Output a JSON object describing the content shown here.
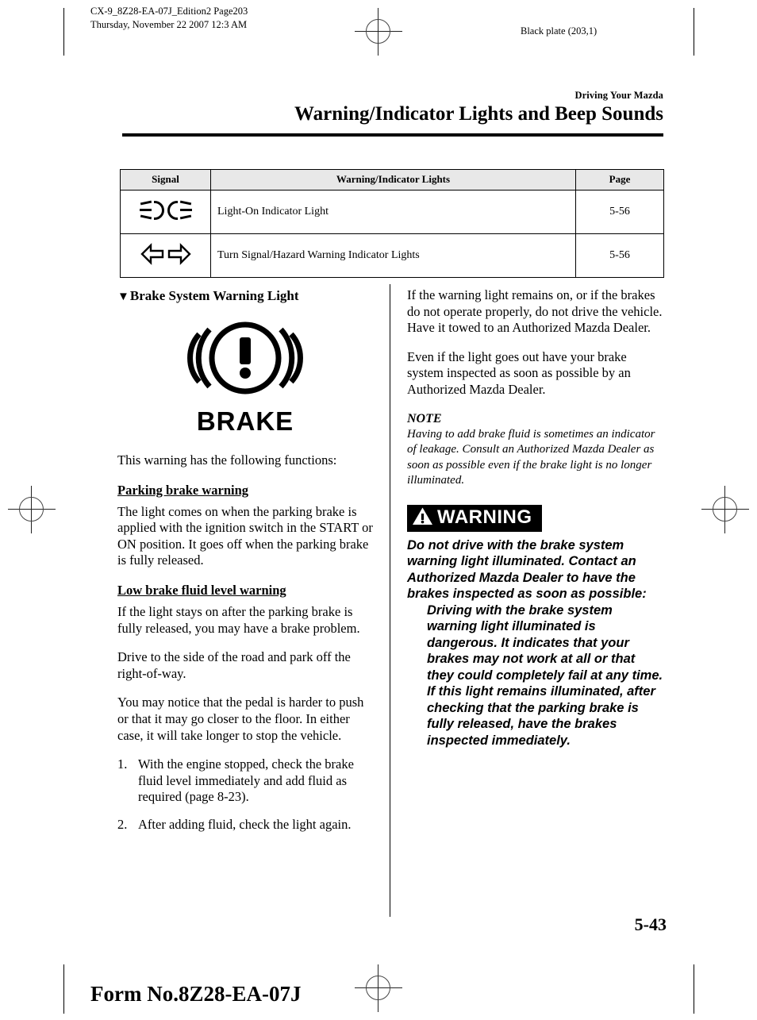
{
  "header": {
    "job_line1": "CX-9_8Z28-EA-07J_Edition2 Page203",
    "job_line2": "Thursday, November 22 2007 12:3 AM",
    "plate": "Black plate (203,1)"
  },
  "section": {
    "kicker": "Driving Your Mazda",
    "title": "Warning/Indicator Lights and Beep Sounds"
  },
  "table": {
    "columns": [
      "Signal",
      "Warning/Indicator Lights",
      "Page"
    ],
    "rows": [
      {
        "icon": "headlight-icon",
        "label": "Light-On Indicator Light",
        "page": "5-56"
      },
      {
        "icon": "turn-signal-arrows-icon",
        "label": "Turn Signal/Hazard Warning Indicator Lights",
        "page": "5-56",
        "glyph_left": "⇦",
        "glyph_right": "⇨"
      }
    ]
  },
  "left_column": {
    "heading_marker": "▼",
    "heading": "Brake System Warning Light",
    "symbol_label": "BRAKE",
    "intro": "This warning has the following functions:",
    "sub1_heading": "Parking brake warning",
    "sub1_body": "The light comes on when the parking brake is applied with the ignition switch in the START or ON position. It goes off when the parking brake is fully released.",
    "sub2_heading": "Low brake fluid level warning",
    "sub2_p1": "If the light stays on after the parking brake is fully released, you may have a brake problem.",
    "sub2_p2": "Drive to the side of the road and park off the right-of-way.",
    "sub2_p3": "You may notice that the pedal is harder to push or that it may go closer to the floor. In either case, it will take longer to stop the vehicle.",
    "steps": [
      {
        "num": "1.",
        "text": "With the engine stopped, check the brake fluid level immediately and add fluid as required (page 8-23)."
      },
      {
        "num": "2.",
        "text": "After adding fluid, check the light again."
      }
    ]
  },
  "right_column": {
    "p1": "If the warning light remains on, or if the brakes do not operate properly, do not drive the vehicle. Have it towed to an Authorized Mazda Dealer.",
    "p2": "Even if the light goes out have your brake system inspected as soon as possible by an Authorized Mazda Dealer.",
    "note_title": "NOTE",
    "note_body": "Having to add brake fluid is sometimes an indicator of leakage. Consult an Authorized Mazda Dealer as soon as possible even if the brake light is no longer illuminated.",
    "warning_label": "WARNING",
    "warning_lead": "Do not drive with the brake system warning light illuminated. Contact an Authorized Mazda Dealer to have the brakes inspected as soon as possible:",
    "warning_detail": "Driving with the brake system warning light illuminated is dangerous. It indicates that your brakes may not work at all or that they could completely fail at any time. If this light remains illuminated, after checking that the parking brake is fully released, have the brakes inspected immediately."
  },
  "footer": {
    "folio": "5-43",
    "form_no": "Form No.8Z28-EA-07J"
  },
  "colors": {
    "ink": "#000000",
    "table_header_fill": "#e8e8e8",
    "warning_bar": "#000000",
    "warning_text": "#ffffff"
  }
}
